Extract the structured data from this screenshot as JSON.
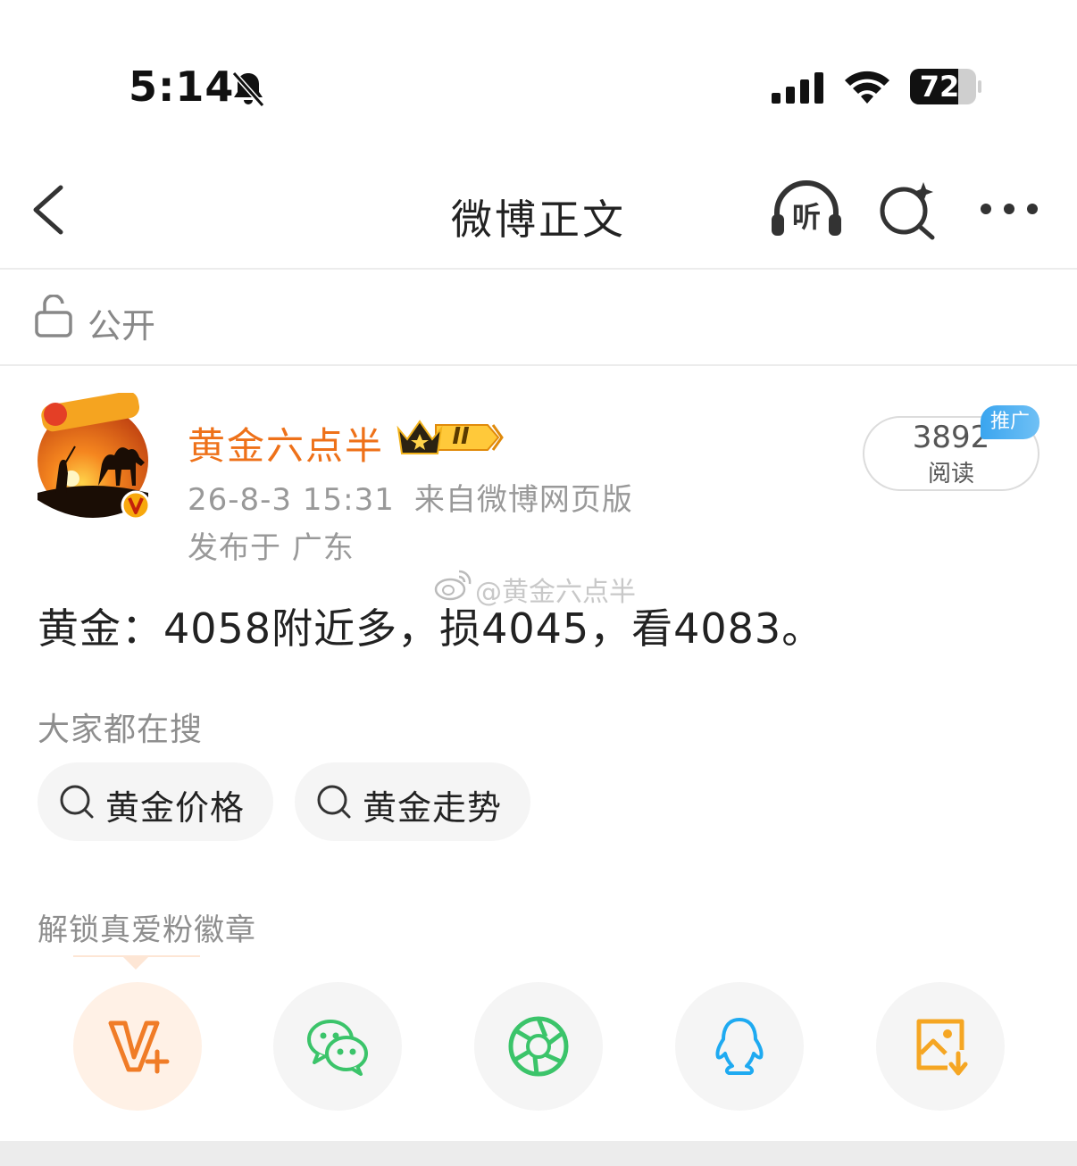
{
  "status_bar": {
    "time": "5:14",
    "battery": "72",
    "icons": [
      "bell-slash-icon",
      "cellular-signal-icon",
      "wifi-icon",
      "battery-icon"
    ]
  },
  "nav": {
    "title": "微博正文",
    "listen_label": "听",
    "icons": [
      "back-chevron-icon",
      "headphones-icon",
      "ai-search-icon",
      "more-dots-icon"
    ]
  },
  "visibility": {
    "label": "公开",
    "icon": "unlock-icon"
  },
  "post": {
    "author": "黄金六点半",
    "vip_level": "II",
    "date": "26-8-3 15:31",
    "source": "来自微博网页版",
    "location": "发布于 广东",
    "read_count": "3892",
    "read_label": "阅读",
    "promo_tag": "推广",
    "watermark": "@黄金六点半",
    "text": "黄金：4058附近多，损4045，看4083。"
  },
  "hot_search": {
    "title": "大家都在搜",
    "chips": [
      "黄金价格",
      "黄金走势"
    ]
  },
  "fans_badge": {
    "title": "解锁真爱粉徽章"
  },
  "share_targets": [
    "vplus-icon",
    "wechat-icon",
    "moments-icon",
    "qq-icon",
    "save-image-icon"
  ],
  "colors": {
    "author": "#ee7119",
    "secondary_text": "#999999",
    "promo_blue": "#3aa5ef",
    "wechat_green": "#3bc46a",
    "qq_blue": "#1eaaf1",
    "save_orange": "#f5a623",
    "vplus_orange": "#f07c27"
  }
}
